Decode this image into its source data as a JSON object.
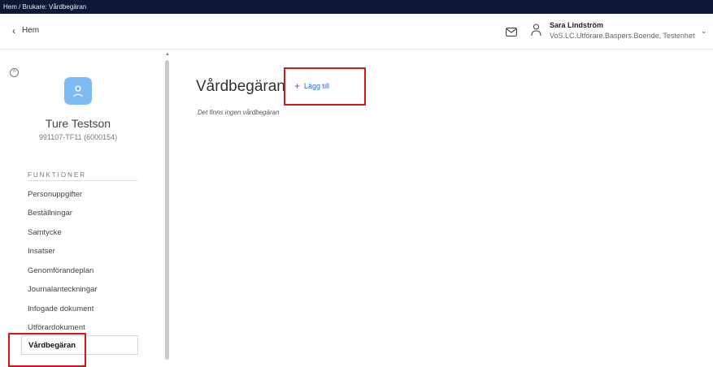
{
  "breadcrumb": "Hem / Brukare: Vårdbegäran",
  "header": {
    "back_label": "Hem",
    "user_name": "Sara Lindström",
    "user_role": "VoS.LC.Utförare.Baspers.Boende, Testenhet"
  },
  "person": {
    "name": "Ture Testson",
    "id": "991107-TF11 (6000154)"
  },
  "sidebar": {
    "heading": "FUNKTIONER",
    "items": [
      {
        "label": "Personuppgifter"
      },
      {
        "label": "Beställningar"
      },
      {
        "label": "Samtycke"
      },
      {
        "label": "Insatser"
      },
      {
        "label": "Genomförandeplan"
      },
      {
        "label": "Journalanteckningar"
      },
      {
        "label": "Infogade dokument"
      },
      {
        "label": "Utförardokument"
      },
      {
        "label": "Vårdbegäran"
      }
    ],
    "active_index": 8
  },
  "main": {
    "title": "Vårdbegäran",
    "add_label": "Lägg till",
    "empty_message": "Det finns ingen vårdbegäran"
  },
  "colors": {
    "topbar": "#0e1738",
    "avatar": "#7dbbf1",
    "link": "#2a6bd6",
    "highlight": "#d9141a"
  },
  "icons": [
    "chevron-left-icon",
    "mail-icon",
    "user-icon",
    "chevron-down-icon",
    "chevron-up-icon",
    "person-avatar-icon",
    "plus-icon"
  ]
}
